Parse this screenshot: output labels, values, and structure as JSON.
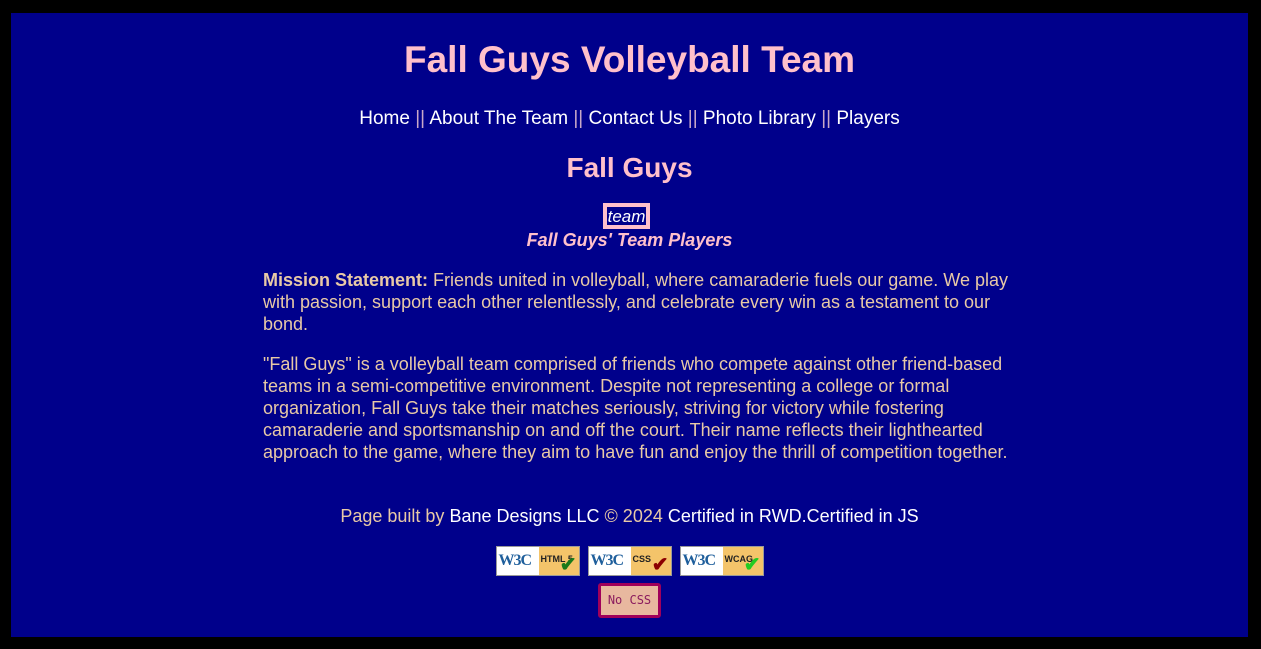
{
  "header": {
    "title": "Fall Guys Volleyball Team"
  },
  "nav": {
    "items": [
      "Home",
      "About The Team",
      "Contact Us",
      "Photo Library",
      "Players"
    ],
    "separator": "||"
  },
  "main": {
    "section_title": "Fall Guys",
    "image_alt": "team",
    "caption": "Fall Guys' Team Players",
    "mission_label": "Mission Statement:",
    "mission_text": "Friends united in volleyball, where camaraderie fuels our game. We play with passion, support each other relentlessly, and celebrate every win as a testament to our bond.",
    "description": "\"Fall Guys\" is a volleyball team comprised of friends who compete against other friend-based teams in a semi-competitive environment. Despite not representing a college or formal organization, Fall Guys take their matches seriously, striving for victory while fostering camaraderie and sportsmanship on and off the court. Their name reflects their lighthearted approach to the game, where they aim to have fun and enjoy the thrill of competition together."
  },
  "footer": {
    "built_by": "Page built by",
    "company": "Bane Designs LLC",
    "copyright": "© 2024",
    "cert_rwd": "Certified in RWD",
    "cert_sep": ".",
    "cert_js": "Certified in JS",
    "badges": [
      {
        "w3c": "W3C",
        "label": "HTML 5",
        "check_color": "#1a7a1a",
        "icon": "html5-validation-icon"
      },
      {
        "w3c": "W3C",
        "label": "CSS",
        "check_color": "#8b0000",
        "icon": "css-validation-icon"
      },
      {
        "w3c": "W3C",
        "label": "WCAG",
        "check_color": "#22cc22",
        "icon": "wcag-validation-icon"
      }
    ],
    "no_css_label": "No CSS"
  },
  "colors": {
    "background": "#00008b",
    "outer": "#000000",
    "heading": "#ffc0cb",
    "body_text": "#e8c9a6",
    "link": "#ffffff"
  }
}
